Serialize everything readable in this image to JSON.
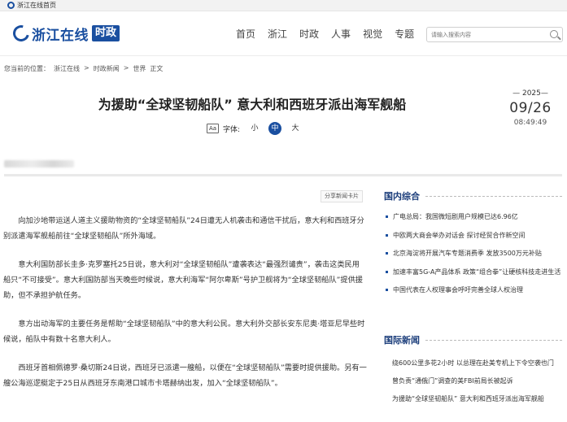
{
  "topbar": {
    "home_link": "浙江在线首页"
  },
  "brand": {
    "logo_text": "浙江在线",
    "section_badge": "时政"
  },
  "nav": {
    "items": [
      "首页",
      "浙江",
      "时政",
      "人事",
      "视觉",
      "专题"
    ]
  },
  "search": {
    "placeholder": "请输入搜索内容"
  },
  "breadcrumb": {
    "items": [
      "您当前的位置：",
      "浙江在线",
      ">",
      "时政新闻",
      ">",
      "世界",
      "正文"
    ]
  },
  "article": {
    "title": "为援助“全球坚韧船队” 意大利和西班牙派出海军舰船",
    "font_control": {
      "icon_label": "Aa",
      "label": "字体:",
      "options": [
        "小",
        "中",
        "大"
      ],
      "selected": "中"
    },
    "date": {
      "year": "— 2025—",
      "month_day": "09/26",
      "time": "08:49:49"
    },
    "share_label": "分享新闻卡片",
    "paragraphs": [
      "向加沙地带运送人道主义援助物资的“全球坚韧船队”24日遭无人机袭击和通信干扰后，意大利和西班牙分别派遣海军舰船前往“全球坚韧船队”所外海域。",
      "意大利国防部长圭多·克罗塞托25日说，意大利对“全球坚韧船队”遭袭表达“最强烈谴责”，袭击这类民用船只“不可接受”。意大利国防部当天晚些时候说，意大利海军“阿尔卑斯”号护卫舰将为“全球坚韧船队”提供援助，但不承担护航任务。",
      "意方出动海军的主要任务是帮助“全球坚韧船队”中的意大利公民。意大利外交部长安东尼奥·塔亚尼早些时候说，船队中有数十名意大利人。",
      "西班牙首相佩德罗·桑切斯24日说，西班牙已派遣一艘船，以便在“全球坚韧船队”需要时提供援助。另有一艘公海巡逻艇定于25日从西班牙东南港口城市卡塔赫纳出发，加入“全球坚韧船队”。"
    ]
  },
  "sidebar": {
    "domestic": {
      "title": "国内综合",
      "items": [
        "广电总局：我国微短剧用户规模已达6.96亿",
        "中欧两大商会举办对话会 探讨经贸合作新空间",
        "北京海淀将开展汽车专题消费季 发放3500万元补贴",
        "加速丰富5G-A产品体系 政策“组合拳”让硬核科技走进生活",
        "中国代表在人权理事会呼吁完善全球人权治理"
      ]
    },
    "international": {
      "title": "国际新闻",
      "items": [
        "绕600公里多花2小时 以总理在赴美专机上下令空袭也门",
        "曾负责“通俄门”调查的美FBI前局长被起诉",
        "为援助“全球坚韧船队” 意大利和西班牙派出海军舰船"
      ]
    }
  },
  "colors": {
    "brand_blue": "#1a4fa0",
    "sidebar_title": "#1a3c7a"
  }
}
